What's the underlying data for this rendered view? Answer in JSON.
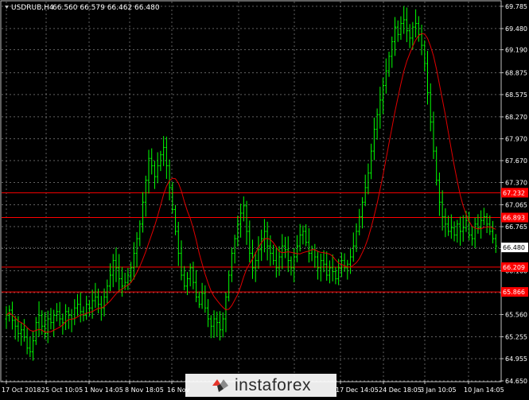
{
  "header": {
    "symbol": "USDRUB,H4",
    "ohlc": "66.560 66.579 66.462 66.480"
  },
  "watermark": {
    "text": "instaforex"
  },
  "colors": {
    "background": "#000000",
    "candle": "#00ff00",
    "ma": "#ff0000",
    "level": "#ff0000",
    "grid": "#c0c0c0",
    "axis_text": "#ffffff",
    "current_price_bg": "#ffffff"
  },
  "chart_data": {
    "type": "candlestick",
    "symbol": "USDRUB",
    "timeframe": "H4",
    "ylim": [
      64.65,
      69.85
    ],
    "y_ticks": [
      "69.785",
      "69.480",
      "69.190",
      "68.875",
      "68.575",
      "68.270",
      "67.970",
      "67.670",
      "67.370",
      "67.065",
      "66.765",
      "66.465",
      "66.160",
      "65.860",
      "65.560",
      "65.255",
      "64.955",
      "64.650"
    ],
    "x_ticks": [
      "17 Oct 2018",
      "25 Oct 10:05",
      "1 Nov 14:05",
      "8 Nov 18:05",
      "16 Nov",
      "",
      "",
      "17 Dec 14:05",
      "24 Dec 18:05",
      "3 Jan 10:05",
      "10 Jan 14:05"
    ],
    "levels": [
      {
        "label": "67.232",
        "value": 67.23
      },
      {
        "label": "66.893",
        "value": 66.89
      },
      {
        "label": "66.209",
        "value": 66.21
      },
      {
        "label": "65.866",
        "value": 65.87
      }
    ],
    "current_price": {
      "label": "66.480",
      "value": 66.48
    },
    "close_series": [
      65.55,
      65.62,
      65.48,
      65.4,
      65.3,
      65.35,
      65.25,
      65.1,
      65.05,
      65.2,
      65.45,
      65.55,
      65.4,
      65.3,
      65.5,
      65.45,
      65.55,
      65.6,
      65.5,
      65.45,
      65.6,
      65.55,
      65.5,
      65.65,
      65.7,
      65.6,
      65.55,
      65.7,
      65.65,
      65.75,
      65.8,
      65.7,
      65.65,
      65.8,
      65.95,
      66.1,
      66.3,
      66.2,
      66.05,
      65.95,
      66.0,
      66.1,
      66.2,
      66.4,
      66.6,
      66.8,
      67.1,
      67.4,
      67.7,
      67.6,
      67.45,
      67.6,
      67.75,
      67.85,
      67.6,
      67.3,
      67.0,
      66.7,
      66.4,
      66.1,
      65.95,
      66.05,
      66.2,
      66.0,
      65.8,
      65.7,
      65.85,
      65.65,
      65.5,
      65.4,
      65.5,
      65.45,
      65.35,
      65.5,
      65.8,
      66.1,
      66.4,
      66.6,
      66.8,
      66.95,
      67.05,
      66.7,
      66.4,
      66.2,
      66.3,
      66.45,
      66.6,
      66.7,
      66.5,
      66.4,
      66.3,
      66.2,
      66.35,
      66.5,
      66.45,
      66.3,
      66.2,
      66.35,
      66.5,
      66.65,
      66.7,
      66.55,
      66.4,
      66.45,
      66.35,
      66.2,
      66.3,
      66.25,
      66.1,
      66.2,
      66.15,
      66.05,
      66.2,
      66.3,
      66.2,
      66.25,
      66.35,
      66.5,
      66.7,
      66.9,
      67.1,
      67.3,
      67.5,
      67.8,
      68.1,
      68.3,
      68.5,
      68.7,
      68.9,
      69.1,
      69.3,
      69.5,
      69.4,
      69.55,
      69.6,
      69.45,
      69.35,
      69.5,
      69.55,
      69.4,
      69.25,
      69.0,
      68.6,
      68.2,
      67.8,
      67.4,
      67.1,
      66.9,
      66.8,
      66.7,
      66.75,
      66.65,
      66.8,
      66.7,
      66.75,
      66.85,
      66.65,
      66.6,
      66.8,
      66.75,
      66.85,
      66.9,
      66.8,
      66.7,
      66.6,
      66.5
    ]
  }
}
